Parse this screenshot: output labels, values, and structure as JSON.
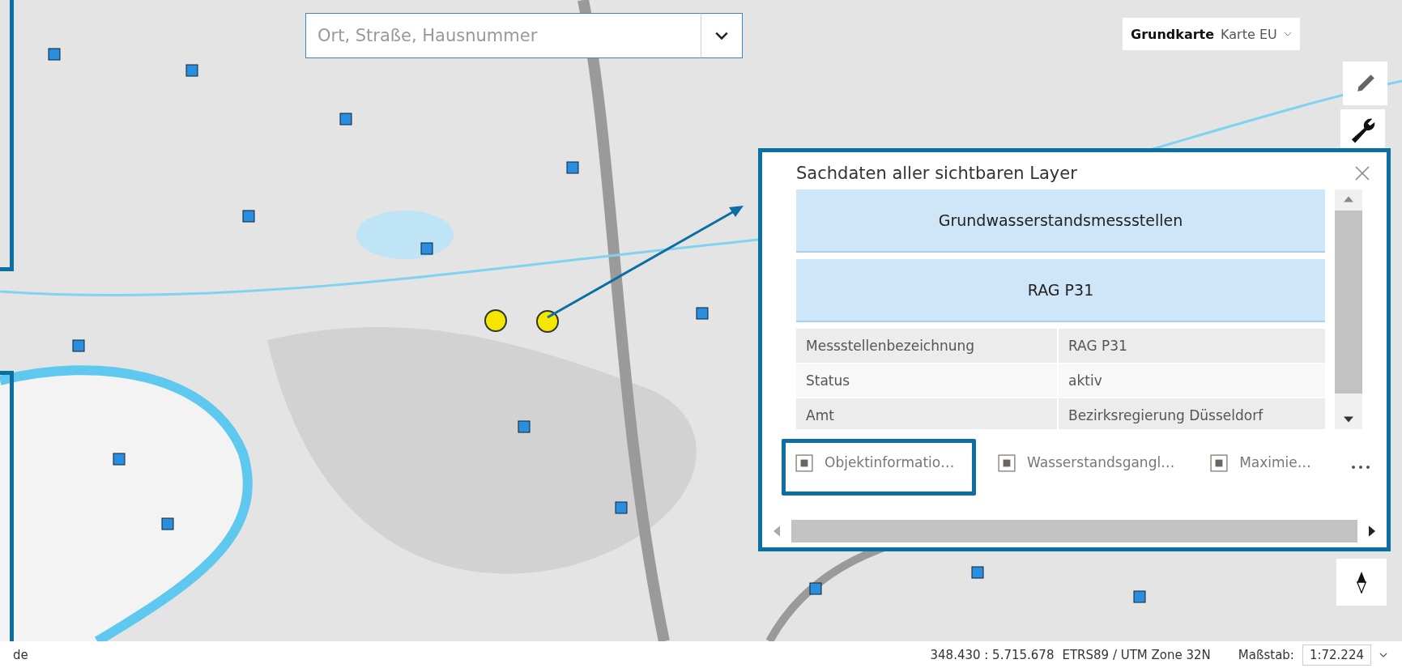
{
  "search": {
    "placeholder": "Ort, Straße, Hausnummer"
  },
  "basemap": {
    "label": "Grundkarte",
    "value": "Karte EU"
  },
  "popup": {
    "title": "Sachdaten aller sichtbaren Layer",
    "sections": [
      "Grundwasserstandsmessstellen",
      "RAG P31"
    ],
    "attributes": [
      {
        "name": "Messstellenbezeichnung",
        "value": "RAG P31"
      },
      {
        "name": "Status",
        "value": "aktiv"
      },
      {
        "name": "Amt",
        "value": "Bezirksregierung Düsseldorf"
      }
    ],
    "actions": [
      {
        "label": "Objektinformatio…",
        "highlighted": true
      },
      {
        "label": "Wasserstandsgangl…",
        "highlighted": false
      },
      {
        "label": "Maximie…",
        "highlighted": false
      }
    ]
  },
  "status_bar": {
    "left": "de",
    "coordinates": "348.430 : 5.715.678",
    "projection": "ETRS89 / UTM Zone 32N",
    "scale_label": "Maßstab:",
    "scale": "1:72.224"
  }
}
